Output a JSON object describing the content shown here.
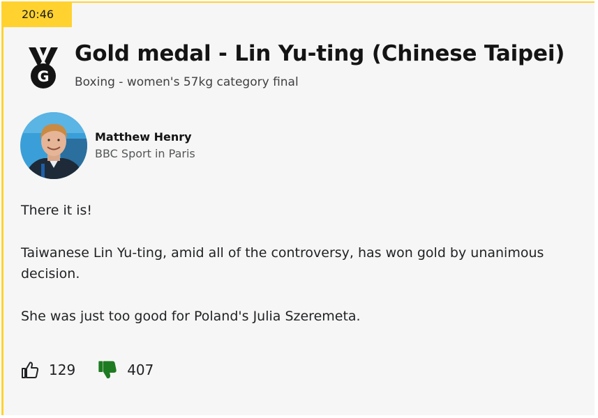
{
  "post": {
    "time": "20:46",
    "title": "Gold medal - Lin Yu-ting (Chinese Taipei)",
    "subtitle": "Boxing - women's 57kg category final",
    "medal_icon": "gold-medal-icon",
    "medal_letter": "G"
  },
  "author": {
    "name": "Matthew Henry",
    "role": "BBC Sport in Paris"
  },
  "body": {
    "paragraphs": [
      "There it is!",
      "Taiwanese Lin Yu-ting, amid all of the controversy, has won gold by unanimous decision.",
      "She was just too good for Poland's Julia Szeremeta."
    ]
  },
  "reactions": {
    "likes": "129",
    "dislikes": "407",
    "like_icon": "thumbs-up-icon",
    "dislike_icon": "thumbs-down-icon",
    "dislike_color": "#1e7b22"
  }
}
